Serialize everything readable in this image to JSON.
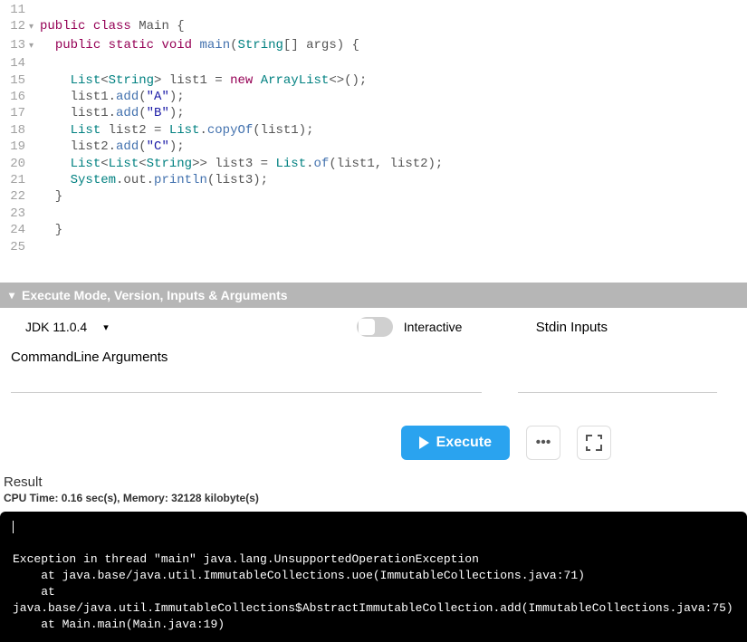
{
  "editor": {
    "lines": [
      {
        "num": "11",
        "fold": "",
        "tokens": []
      },
      {
        "num": "12",
        "fold": "▾",
        "tokens": [
          {
            "c": "kw",
            "t": "public"
          },
          {
            "c": "",
            "t": " "
          },
          {
            "c": "kw",
            "t": "class"
          },
          {
            "c": "",
            "t": " "
          },
          {
            "c": "cls",
            "t": "Main"
          },
          {
            "c": "",
            "t": " {"
          }
        ]
      },
      {
        "num": "13",
        "fold": "▾",
        "tokens": [
          {
            "c": "",
            "t": "  "
          },
          {
            "c": "kw",
            "t": "public"
          },
          {
            "c": "",
            "t": " "
          },
          {
            "c": "kw",
            "t": "static"
          },
          {
            "c": "",
            "t": " "
          },
          {
            "c": "kw",
            "t": "void"
          },
          {
            "c": "",
            "t": " "
          },
          {
            "c": "mth",
            "t": "main"
          },
          {
            "c": "",
            "t": "("
          },
          {
            "c": "typ",
            "t": "String"
          },
          {
            "c": "",
            "t": "[] args) {"
          }
        ]
      },
      {
        "num": "14",
        "fold": "",
        "tokens": []
      },
      {
        "num": "15",
        "fold": "",
        "tokens": [
          {
            "c": "",
            "t": "    "
          },
          {
            "c": "typ",
            "t": "List"
          },
          {
            "c": "",
            "t": "<"
          },
          {
            "c": "typ",
            "t": "String"
          },
          {
            "c": "",
            "t": "> list1 = "
          },
          {
            "c": "kw",
            "t": "new"
          },
          {
            "c": "",
            "t": " "
          },
          {
            "c": "typ",
            "t": "ArrayList"
          },
          {
            "c": "",
            "t": "<>();"
          }
        ]
      },
      {
        "num": "16",
        "fold": "",
        "tokens": [
          {
            "c": "",
            "t": "    list1."
          },
          {
            "c": "mth",
            "t": "add"
          },
          {
            "c": "",
            "t": "("
          },
          {
            "c": "str",
            "t": "\"A\""
          },
          {
            "c": "",
            "t": ");"
          }
        ]
      },
      {
        "num": "17",
        "fold": "",
        "tokens": [
          {
            "c": "",
            "t": "    list1."
          },
          {
            "c": "mth",
            "t": "add"
          },
          {
            "c": "",
            "t": "("
          },
          {
            "c": "str",
            "t": "\"B\""
          },
          {
            "c": "",
            "t": ");"
          }
        ]
      },
      {
        "num": "18",
        "fold": "",
        "tokens": [
          {
            "c": "",
            "t": "    "
          },
          {
            "c": "typ",
            "t": "List"
          },
          {
            "c": "",
            "t": " list2 = "
          },
          {
            "c": "typ",
            "t": "List"
          },
          {
            "c": "",
            "t": "."
          },
          {
            "c": "mth",
            "t": "copyOf"
          },
          {
            "c": "",
            "t": "(list1);"
          }
        ]
      },
      {
        "num": "19",
        "fold": "",
        "tokens": [
          {
            "c": "",
            "t": "    list2."
          },
          {
            "c": "mth",
            "t": "add"
          },
          {
            "c": "",
            "t": "("
          },
          {
            "c": "str",
            "t": "\"C\""
          },
          {
            "c": "",
            "t": ");"
          }
        ]
      },
      {
        "num": "20",
        "fold": "",
        "tokens": [
          {
            "c": "",
            "t": "    "
          },
          {
            "c": "typ",
            "t": "List"
          },
          {
            "c": "",
            "t": "<"
          },
          {
            "c": "typ",
            "t": "List"
          },
          {
            "c": "",
            "t": "<"
          },
          {
            "c": "typ",
            "t": "String"
          },
          {
            "c": "",
            "t": ">> list3 = "
          },
          {
            "c": "typ",
            "t": "List"
          },
          {
            "c": "",
            "t": "."
          },
          {
            "c": "mth",
            "t": "of"
          },
          {
            "c": "",
            "t": "(list1, list2);"
          }
        ]
      },
      {
        "num": "21",
        "fold": "",
        "tokens": [
          {
            "c": "",
            "t": "    "
          },
          {
            "c": "typ",
            "t": "System"
          },
          {
            "c": "",
            "t": ".out."
          },
          {
            "c": "mth",
            "t": "println"
          },
          {
            "c": "",
            "t": "(list3);"
          }
        ]
      },
      {
        "num": "22",
        "fold": "",
        "tokens": [
          {
            "c": "",
            "t": "  }"
          }
        ]
      },
      {
        "num": "23",
        "fold": "",
        "tokens": []
      },
      {
        "num": "24",
        "fold": "",
        "tokens": [
          {
            "c": "",
            "t": "  }"
          }
        ]
      },
      {
        "num": "25",
        "fold": "",
        "tokens": []
      }
    ]
  },
  "settings": {
    "header": "Execute Mode, Version, Inputs & Arguments",
    "jdk_version": "JDK 11.0.4",
    "interactive_label": "Interactive",
    "stdin_label": "Stdin Inputs",
    "args_label": "CommandLine Arguments"
  },
  "actions": {
    "execute_label": "Execute"
  },
  "result": {
    "label": "Result",
    "stats": "CPU Time: 0.16 sec(s), Memory: 32128 kilobyte(s)",
    "console_lines": [
      "",
      "Exception in thread \"main\" java.lang.UnsupportedOperationException",
      "    at java.base/java.util.ImmutableCollections.uoe(ImmutableCollections.java:71)",
      "    at java.base/java.util.ImmutableCollections$AbstractImmutableCollection.add(ImmutableCollections.java:75)",
      "    at Main.main(Main.java:19)"
    ]
  }
}
